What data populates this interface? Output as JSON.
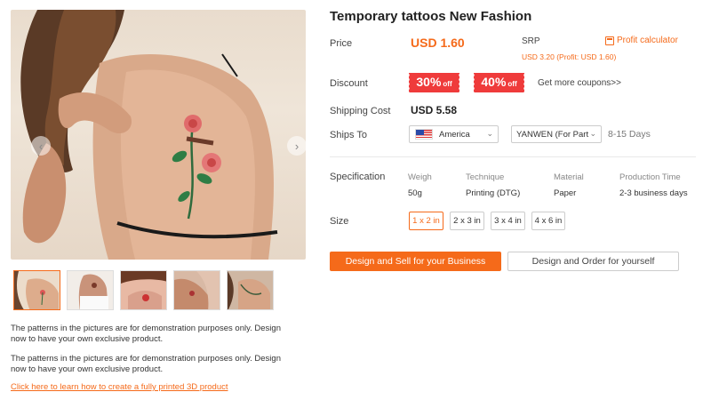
{
  "product": {
    "title": "Temporary tattoos New Fashion",
    "price_label": "Price",
    "price": "USD 1.60",
    "srp_label": "SRP",
    "srp_value": "USD 3.20 (Profit: USD 1.60)",
    "profit_calculator": "Profit calculator",
    "discount_label": "Discount",
    "coupons": [
      {
        "value": "30%",
        "suffix": "off"
      },
      {
        "value": "40%",
        "suffix": "off"
      }
    ],
    "more_coupons": "Get more coupons>>",
    "shipping_cost_label": "Shipping Cost",
    "shipping_cost": "USD 5.58",
    "ships_to_label": "Ships To",
    "country": "America",
    "shipping_method": "YANWEN (For Part",
    "delivery_days": "8-15 Days",
    "specification_label": "Specification",
    "specs": [
      {
        "head": "Weigh",
        "value": "50g"
      },
      {
        "head": "Technique",
        "value": "Printing (DTG)"
      },
      {
        "head": "Material",
        "value": "Paper"
      },
      {
        "head": "Production Time",
        "value": "2-3 business days"
      }
    ],
    "size_label": "Size",
    "sizes": [
      "1 x 2 in",
      "2 x 3 in",
      "3 x 4 in",
      "4 x 6 in"
    ],
    "selected_size": "1 x 2 in",
    "primary_button": "Design and Sell for your Business",
    "secondary_button": "Design and Order for yourself"
  },
  "gallery": {
    "prev_arrow": "‹",
    "next_arrow": "›",
    "thumbnail_count": 5,
    "notes": [
      "The patterns in the pictures are for demonstration purposes only. Design now to have your own exclusive product.",
      "The patterns in the pictures are for demonstration purposes only. Design now to have your own exclusive product."
    ],
    "learn_link": "Click here to learn how to create a fully printed 3D product"
  },
  "colors": {
    "accent": "#f56a1a",
    "coupon": "#ef3b3b"
  }
}
